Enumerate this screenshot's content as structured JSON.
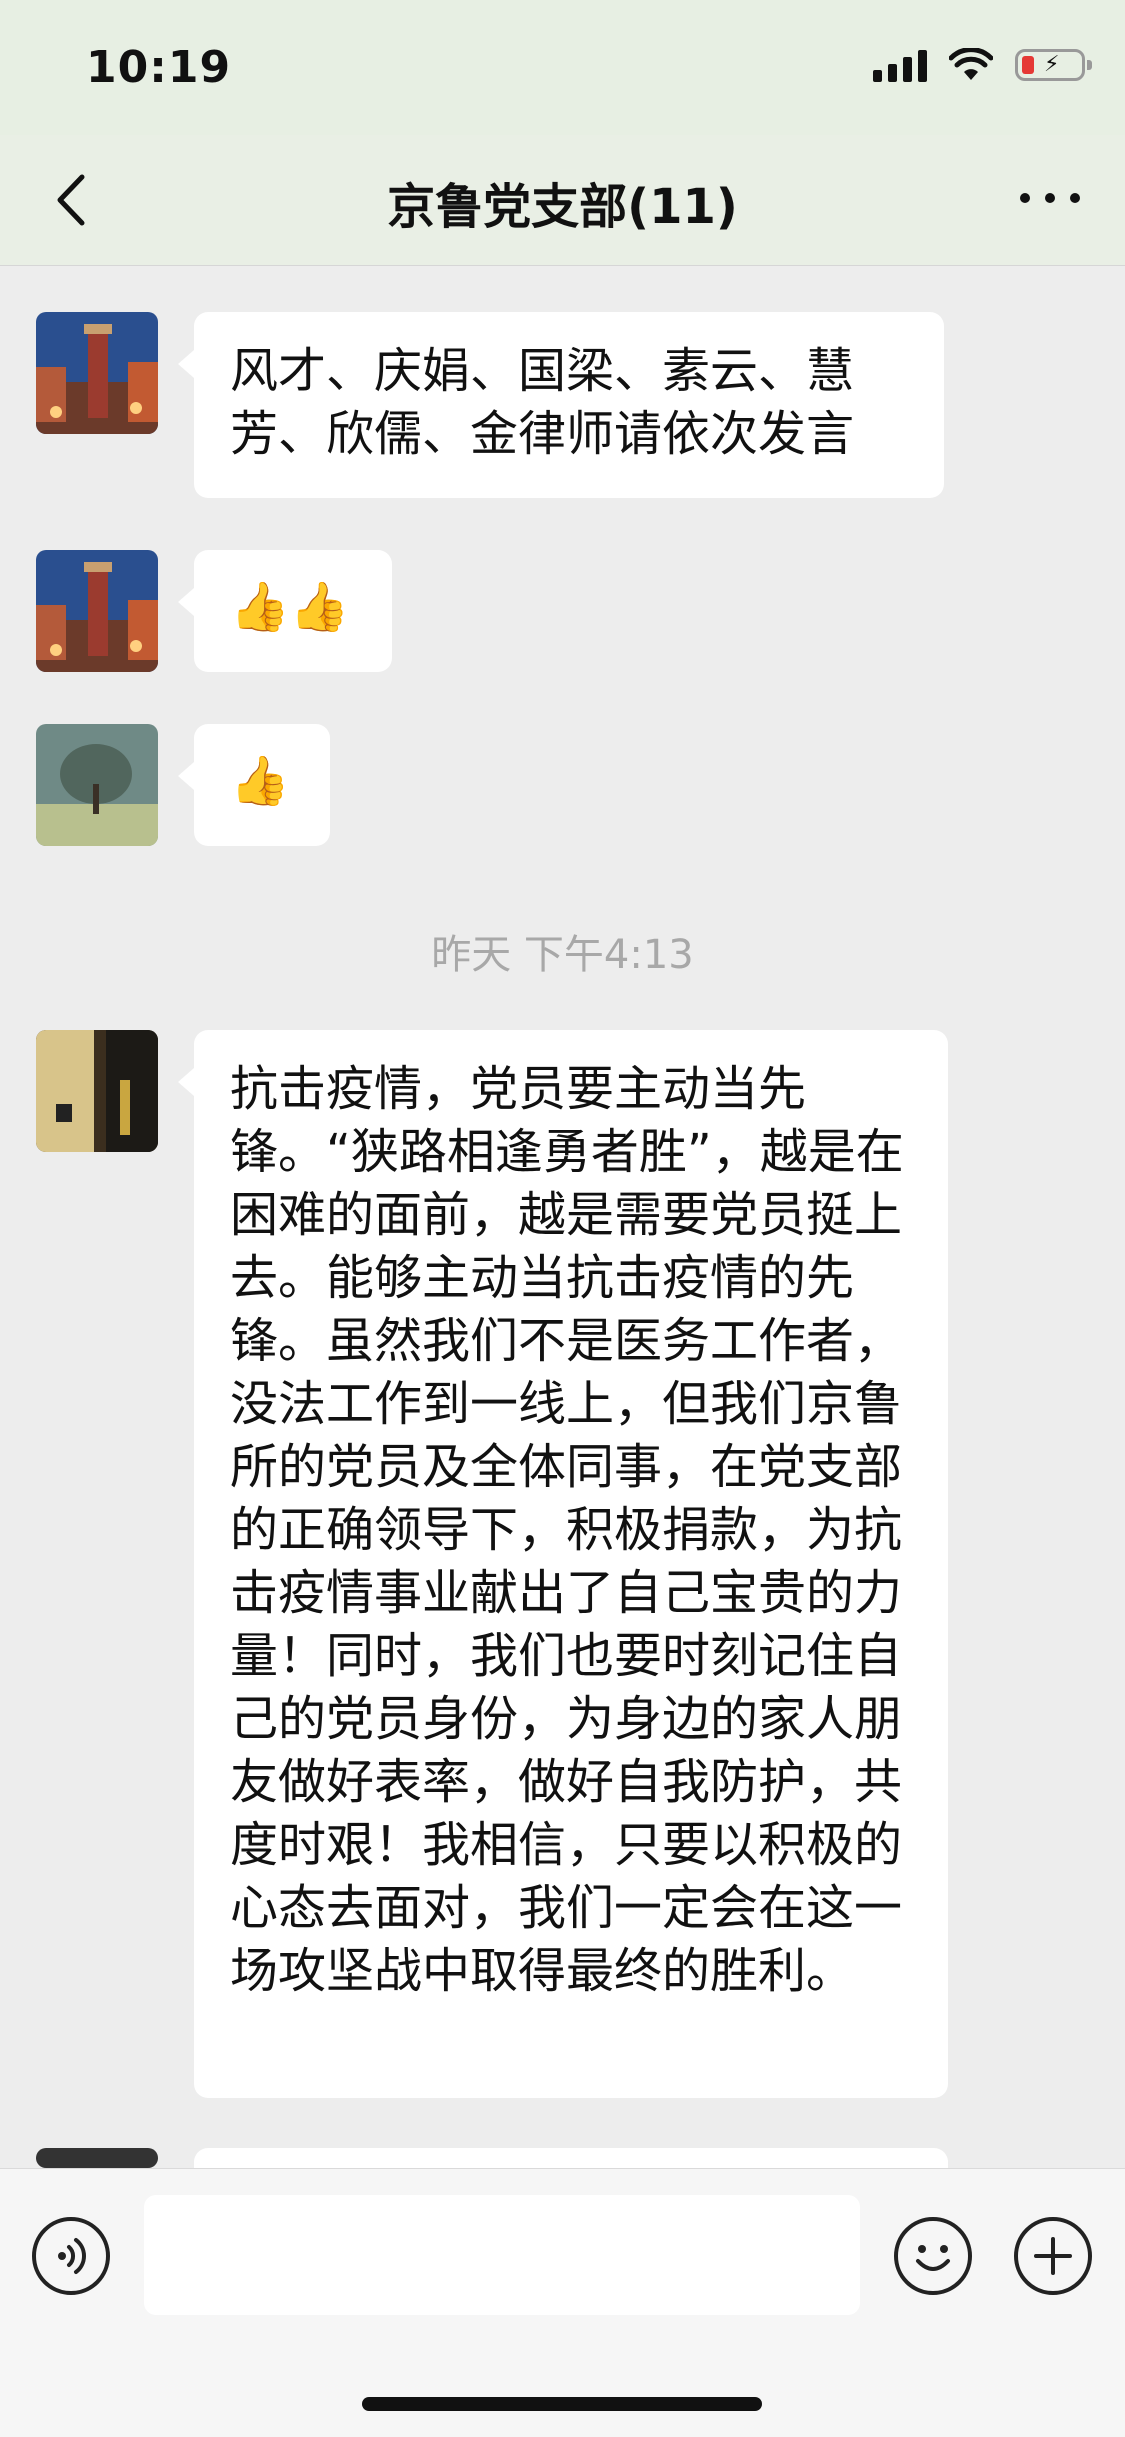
{
  "status_bar": {
    "time": "10:19"
  },
  "nav": {
    "title": "京鲁党支部(11)"
  },
  "messages": [
    {
      "avatar": "tower-night-avatar",
      "text": "风才、庆娟、国梁、素云、慧芳、欣儒、金律师请依次发言"
    },
    {
      "avatar": "tower-night-avatar",
      "text": "👍👍"
    },
    {
      "avatar": "tree-landscape-avatar",
      "text": "👍"
    },
    {
      "avatar": "night-street-avatar",
      "text": "抗击疫情，党员要主动当先锋。“狭路相逢勇者胜”，越是在困难的面前，越是需要党员挺上去。能够主动当抗击疫情的先锋。虽然我们不是医务工作者，没法工作到一线上，但我们京鲁所的党员及全体同事，在党支部的正确领导下，积极捐款，为抗击疫情事业献出了自己宝贵的力量！同时，我们也要时刻记住自己的党员身份，为身边的家人朋友做好表率，做好自我防护，共度时艰！我相信，只要以积极的心态去面对，我们一定会在这一场攻坚战中取得最终的胜利。"
    }
  ],
  "timestamp": "昨天 下午4:13",
  "colors": {
    "chat_bg": "#ededed",
    "bubble_bg": "#ffffff",
    "nav_bg": "#e9efe5"
  },
  "icons": [
    "back-chevron-icon",
    "more-dots-icon",
    "voice-icon",
    "emoji-icon",
    "plus-icon"
  ]
}
